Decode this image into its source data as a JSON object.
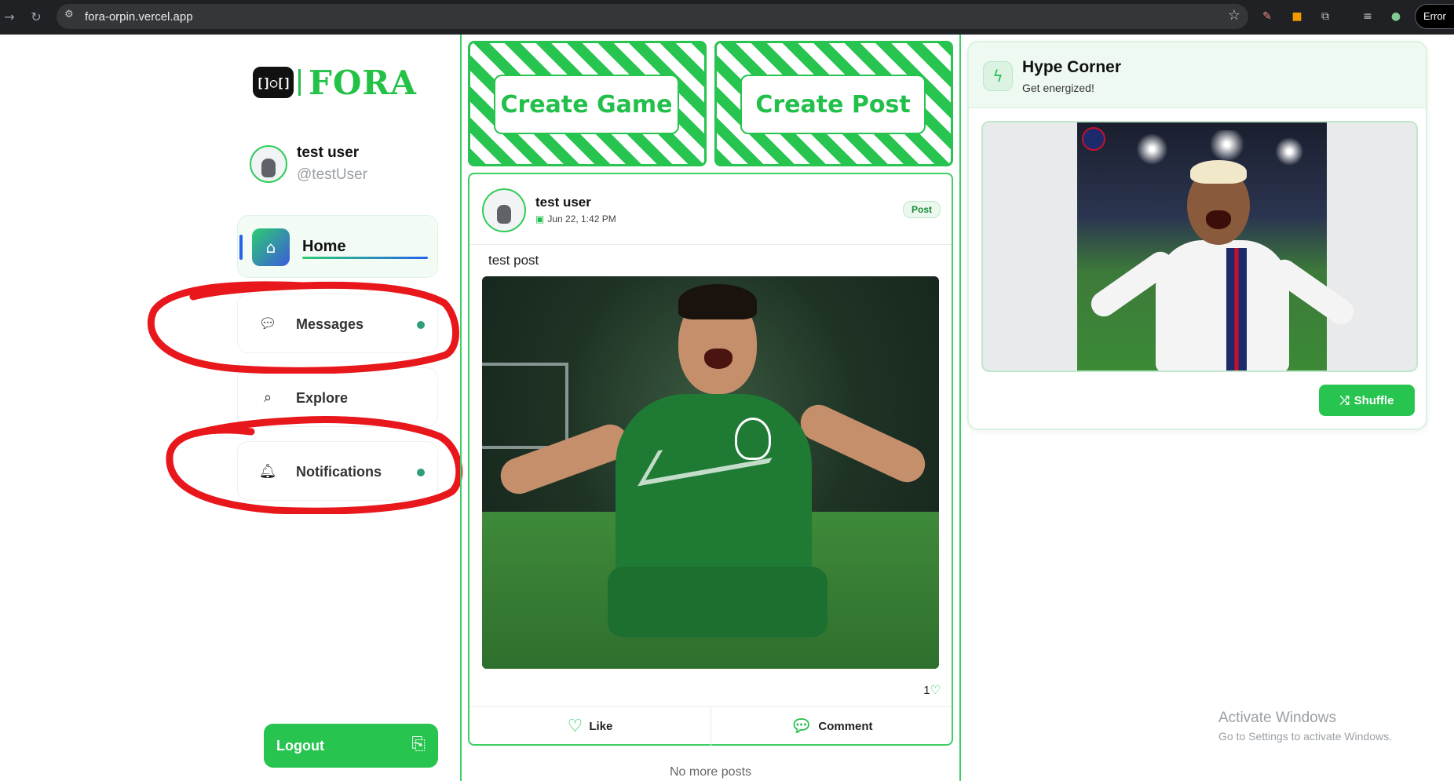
{
  "browser": {
    "url": "fora-orpin.vercel.app",
    "error_label": "Error",
    "icons": [
      "back-icon",
      "reload-icon",
      "site-settings-icon",
      "bookmark-star-icon",
      "extensions-icon",
      "profile-icon"
    ]
  },
  "brand": {
    "mark": "[]○[]",
    "name": "FORA",
    "accent": "#23c247"
  },
  "user": {
    "name": "test user",
    "handle": "@testUser"
  },
  "nav": {
    "home": "Home",
    "messages": "Messages",
    "explore": "Explore",
    "notifications": "Notifications"
  },
  "logout_label": "Logout",
  "actions": {
    "create_game": "Create Game",
    "create_post": "Create Post"
  },
  "post": {
    "author": "test user",
    "date": "Jun 22, 1:42 PM",
    "badge": "Post",
    "text": "test post",
    "likes": "1",
    "like_label": "Like",
    "comment_label": "Comment"
  },
  "feed_end": "No more posts",
  "hype": {
    "title": "Hype Corner",
    "subtitle": "Get energized!",
    "shuffle_label": "Shuffle"
  },
  "activate": {
    "line1": "Activate Windows",
    "line2": "Go to Settings to activate Windows."
  },
  "annotation_color": "#e8171b"
}
